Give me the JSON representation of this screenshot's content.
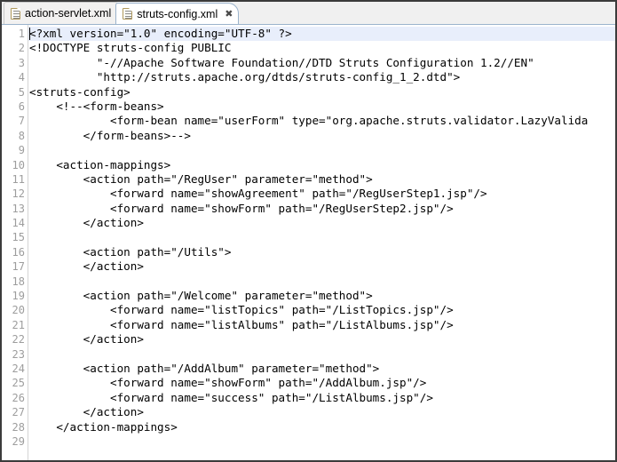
{
  "window": {
    "title": "struts-config.xml",
    "border_color": "#3b3b3b"
  },
  "tabs": {
    "items": [
      {
        "label": "action-servlet.xml",
        "icon": "xml-document-icon",
        "active": false,
        "closable": false
      },
      {
        "label": "struts-config.xml",
        "icon": "xml-document-icon",
        "active": true,
        "closable": true,
        "close_glyph": "✖"
      }
    ]
  },
  "editor": {
    "language": "xml",
    "current_line": 1,
    "caret_line": 1,
    "caret_column": 1,
    "current_line_highlight_color": "#e8eefb",
    "gutter": {
      "line_numbers": [
        "1",
        "2",
        "3",
        "4",
        "5",
        "6",
        "7",
        "8",
        "9",
        "10",
        "11",
        "12",
        "13",
        "14",
        "15",
        "16",
        "17",
        "18",
        "19",
        "20",
        "21",
        "22",
        "23",
        "24",
        "25",
        "26",
        "27",
        "28",
        "29"
      ],
      "number_color": "#9d9d9d"
    },
    "lines": [
      "<?xml version=\"1.0\" encoding=\"UTF-8\" ?>",
      "<!DOCTYPE struts-config PUBLIC",
      "          \"-//Apache Software Foundation//DTD Struts Configuration 1.2//EN\"",
      "          \"http://struts.apache.org/dtds/struts-config_1_2.dtd\">",
      "<struts-config>",
      "    <!--<form-beans>",
      "            <form-bean name=\"userForm\" type=\"org.apache.struts.validator.LazyValida",
      "        </form-beans>-->",
      "",
      "    <action-mappings>",
      "        <action path=\"/RegUser\" parameter=\"method\">",
      "            <forward name=\"showAgreement\" path=\"/RegUserStep1.jsp\"/>",
      "            <forward name=\"showForm\" path=\"/RegUserStep2.jsp\"/>",
      "        </action>",
      "",
      "        <action path=\"/Utils\">",
      "        </action>",
      "",
      "        <action path=\"/Welcome\" parameter=\"method\">",
      "            <forward name=\"listTopics\" path=\"/ListTopics.jsp\"/>",
      "            <forward name=\"listAlbums\" path=\"/ListAlbums.jsp\"/>",
      "        </action>",
      "",
      "        <action path=\"/AddAlbum\" parameter=\"method\">",
      "            <forward name=\"showForm\" path=\"/AddAlbum.jsp\"/>",
      "            <forward name=\"success\" path=\"/ListAlbums.jsp\"/>",
      "        </action>",
      "    </action-mappings>",
      ""
    ]
  }
}
